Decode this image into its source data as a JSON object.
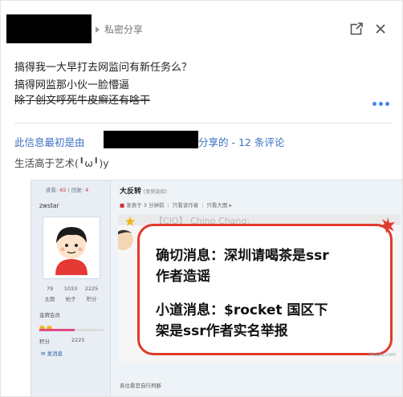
{
  "header": {
    "share_label": "私密分享",
    "open_icon": "open-in-new-icon",
    "close_icon": "close-icon"
  },
  "post": {
    "lines": [
      "搞得我一大早打去网监问有新任务么？",
      "搞得网监那小伙一脸懵逼",
      "除了创文呼死牛皮癣还有啥干"
    ],
    "more_icon": "more-horizontal-icon"
  },
  "origin": {
    "prefix": "此信息最初是由",
    "suffix": "分享的 - 12 条评论"
  },
  "comment": {
    "text": "生活高于艺术(╹ω╹)y"
  },
  "forum": {
    "stats_prefix": "查看: ",
    "views": "65",
    "replies_prefix": " | 回复: ",
    "replies": "4",
    "username": "zwstar",
    "stat_nums": [
      "79",
      "1033",
      "2225"
    ],
    "stat_labels": [
      "主题",
      "帖子",
      "积分"
    ],
    "member_level": "金牌会员",
    "score_label": "积分",
    "score_value": "2225",
    "score_fraction": 0.55,
    "message_link": "发消息",
    "thread_title": "大反转",
    "thread_title_note": "[复制链接]",
    "meta_posted": "发表于 3 分钟前",
    "meta_only_author": "只看该作者",
    "meta_big_image": "只看大图 ▸",
    "image_top_text": "【CIO】 Chino Chang:",
    "bubble_lines": [
      "确切消息：深圳请喝茶是ssr",
      "作者造谣",
      "小道消息：$rocket 国区下",
      "架是ssr作者实名举报"
    ],
    "watermark": "MeiZu.com",
    "footer": "各位看官自行判断"
  }
}
